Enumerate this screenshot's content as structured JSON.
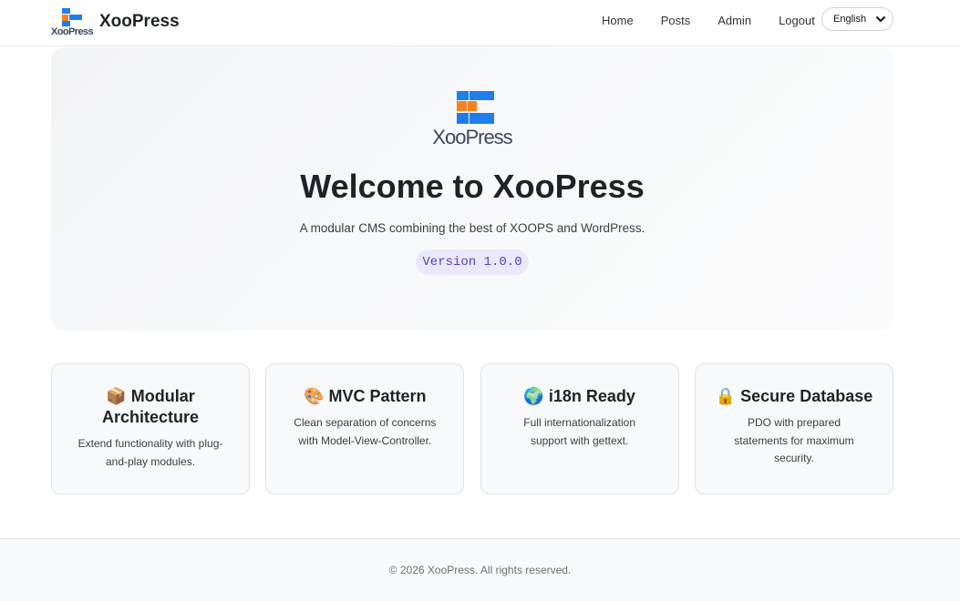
{
  "header": {
    "brand_name": "XooPress",
    "logo_text": "XooPress",
    "nav": [
      {
        "label": "Home"
      },
      {
        "label": "Posts"
      },
      {
        "label": "Admin"
      },
      {
        "label": "Logout"
      }
    ],
    "language": {
      "selected": "English"
    }
  },
  "hero": {
    "logo_text": "XooPress",
    "title": "Welcome to XooPress",
    "subtitle": "A modular CMS combining the best of XOOPS and WordPress.",
    "version": "Version 1.0.0"
  },
  "features": [
    {
      "emoji": "📦",
      "title": "Modular Architecture",
      "description": "Extend functionality with plug-and-play modules."
    },
    {
      "emoji": "🎨",
      "title": "MVC Pattern",
      "description": "Clean separation of concerns with Model-View-Controller."
    },
    {
      "emoji": "🌍",
      "title": "i18n Ready",
      "description": "Full internationalization support with gettext."
    },
    {
      "emoji": "🔒",
      "title": "Secure Database",
      "description": "PDO with prepared statements for maximum security."
    }
  ],
  "footer": {
    "copyright": "© 2026 XooPress. All rights reserved."
  },
  "colors": {
    "logo_orange": "#f7821b",
    "logo_blue": "#1e7ef0",
    "logo_text": "#3b4a5c",
    "badge_bg": "#ece8fb",
    "badge_text": "#5a3fc0"
  }
}
